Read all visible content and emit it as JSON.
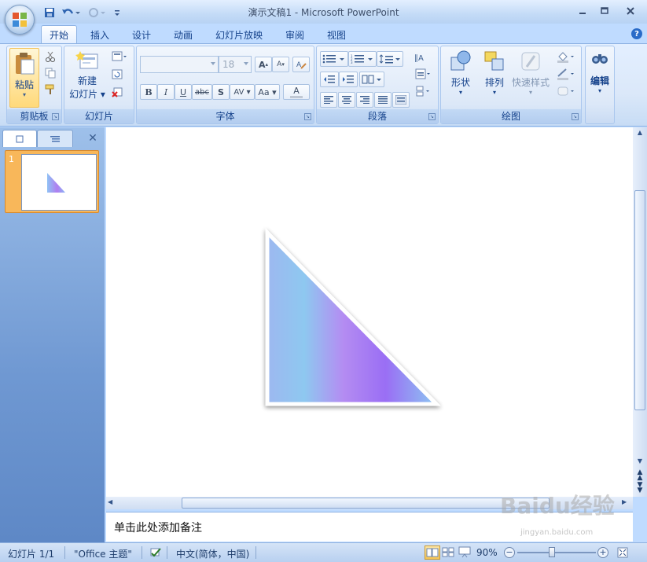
{
  "window": {
    "title": "演示文稿1 - Microsoft PowerPoint"
  },
  "quick_access": [
    "save-icon",
    "undo-icon",
    "redo-icon",
    "customize-icon"
  ],
  "tabs": [
    {
      "label": "开始",
      "active": true
    },
    {
      "label": "插入"
    },
    {
      "label": "设计"
    },
    {
      "label": "动画"
    },
    {
      "label": "幻灯片放映"
    },
    {
      "label": "审阅"
    },
    {
      "label": "视图"
    }
  ],
  "ribbon": {
    "clipboard": {
      "label": "剪贴板",
      "paste": "粘贴"
    },
    "slides": {
      "label": "幻灯片",
      "new_slide_line1": "新建",
      "new_slide_line2": "幻灯片"
    },
    "font": {
      "label": "字体",
      "font_name": "",
      "font_size": "18",
      "bold": "B",
      "italic": "I",
      "underline": "U",
      "strike": "abc",
      "shadow": "S",
      "spacing": "AV",
      "case": "Aa",
      "color": "A",
      "grow": "A",
      "shrink": "A"
    },
    "paragraph": {
      "label": "段落"
    },
    "drawing": {
      "label": "绘图",
      "shapes": "形状",
      "arrange": "排列",
      "quick_styles": "快速样式"
    },
    "editing": {
      "label": "编辑"
    }
  },
  "slide_pane": {
    "slide_number": "1"
  },
  "notes": {
    "placeholder": "单击此处添加备注"
  },
  "status_bar": {
    "slide_info": "幻灯片 1/1",
    "theme": "\"Office 主题\"",
    "language": "中文(简体，中国)",
    "zoom": "90%"
  },
  "watermark": {
    "text": "Baidu经验",
    "sub": "jingyan.baidu.com"
  },
  "colors": {
    "ribbon_blue": "#bfdbff",
    "triangle_start": "#8fc2f4",
    "triangle_mid": "#b07ef0",
    "triangle_end": "#8ab6f6",
    "thumb_selected": "#f8b75a"
  }
}
